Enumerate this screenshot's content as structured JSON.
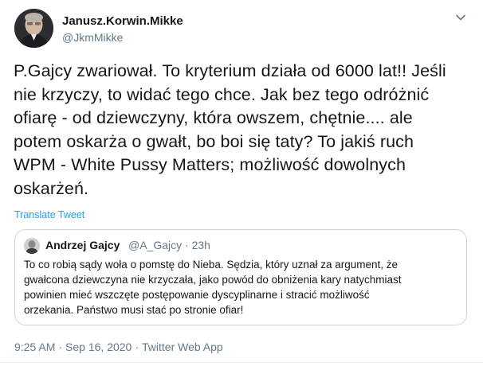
{
  "tweet": {
    "author": {
      "name": "Janusz.Korwin.Mikke",
      "handle": "@JkmMikke"
    },
    "menu_icon": "chevron-down-icon",
    "text_lines": [
      "P.Gajcy zwariował. To kryterium działa od 6000 lat!! Jeśli",
      "nie krzyczy, to widać tego chce. Jak bez tego odróżnić",
      "ofiarę - od dziewczyny, która owszem, chętnie.... ale",
      "potem oskarża o gwałt, bo boi się taty? To jakiś ruch",
      "WPM - White Pussy Matters; możliwość dowolnych",
      "oskarżeń."
    ],
    "translate_label": "Translate Tweet",
    "time": "9:25 AM",
    "date": "Sep 16, 2020",
    "source": "Twitter Web App",
    "separator": "·"
  },
  "quote": {
    "author": {
      "name": "Andrzej Gajcy",
      "handle": "@A_Gajcy · 23h"
    },
    "text_lines": [
      "To co robią sądy woła o pomstę do Nieba. Sędzia, który uznał za argument, że",
      "gwałcona dziewczyna nie krzyczała, jako powód do obniżenia kary natychmiast",
      "powinien mieć wszczęte postępowanie dyscyplinarne i stracić możliwość",
      "orzekania. Państwo musi stać po stronie ofiar!"
    ]
  },
  "colors": {
    "text": "#14171a",
    "secondary": "#657786",
    "link": "#1da1f2",
    "border": "#ccd6dd"
  }
}
